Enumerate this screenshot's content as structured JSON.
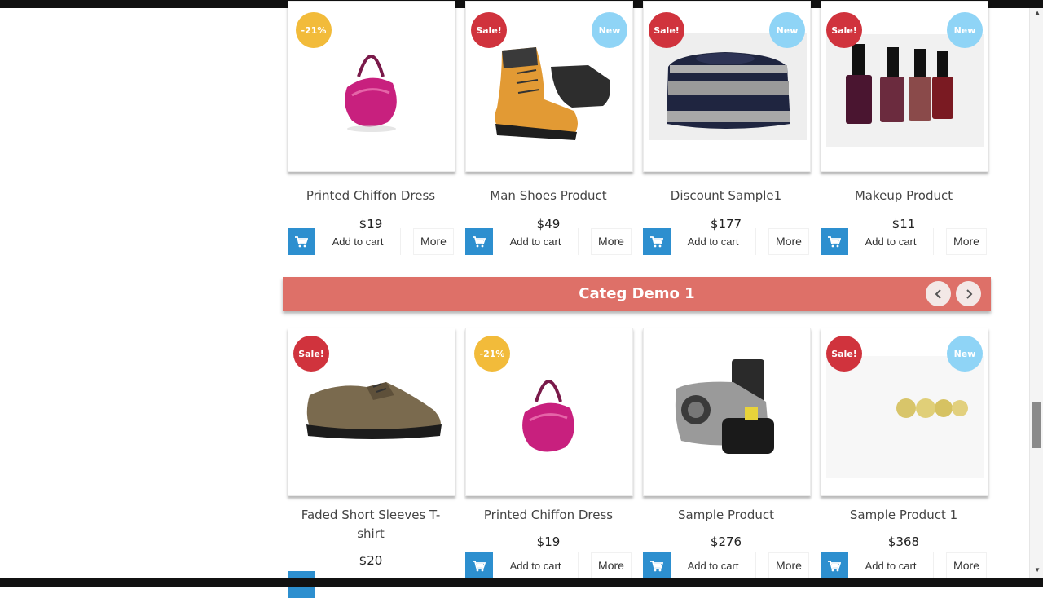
{
  "colors": {
    "accent_cart": "#2d8fcf",
    "category_bar": "#de7068",
    "sale_badge": "#d0333d",
    "discount_badge": "#f2bb3a",
    "new_badge": "#8fd4f6"
  },
  "row1": [
    {
      "name": "Printed Chiffon Dress",
      "price": "$19",
      "badges": {
        "left": "-21%",
        "right": ""
      },
      "image": "pink-handbag",
      "cart_label": "Add to cart",
      "more_label": "More"
    },
    {
      "name": "Man Shoes Product",
      "price": "$49",
      "badges": {
        "left": "Sale!",
        "right": "New"
      },
      "image": "hiking-boots",
      "cart_label": "Add to cart",
      "more_label": "More"
    },
    {
      "name": "Discount Sample1",
      "price": "$177",
      "badges": {
        "left": "Sale!",
        "right": "New"
      },
      "image": "striped-sweater",
      "cart_label": "Add to cart",
      "more_label": "More"
    },
    {
      "name": "Makeup Product",
      "price": "$11",
      "badges": {
        "left": "Sale!",
        "right": "New"
      },
      "image": "nail-polish-bottles",
      "cart_label": "Add to cart",
      "more_label": "More"
    }
  ],
  "category": {
    "title": "Categ Demo 1",
    "prev_icon": "chevron-left-icon",
    "next_icon": "chevron-right-icon"
  },
  "row2": [
    {
      "name": "Faded Short Sleeves T-shirt",
      "price": "$20",
      "badges": {
        "left": "Sale!",
        "right": ""
      },
      "image": "brown-shoe"
    },
    {
      "name": "Printed Chiffon Dress",
      "price": "$19",
      "badges": {
        "left": "-21%",
        "right": ""
      },
      "image": "pink-handbag",
      "cart_label": "Add to cart",
      "more_label": "More"
    },
    {
      "name": "Sample Product",
      "price": "$276",
      "badges": {
        "left": "",
        "right": ""
      },
      "image": "camera",
      "cart_label": "Add to cart",
      "more_label": "More"
    },
    {
      "name": "Sample Product 1",
      "price": "$368",
      "badges": {
        "left": "Sale!",
        "right": "New"
      },
      "image": "gold-balls",
      "cart_label": "Add to cart",
      "more_label": "More"
    }
  ]
}
